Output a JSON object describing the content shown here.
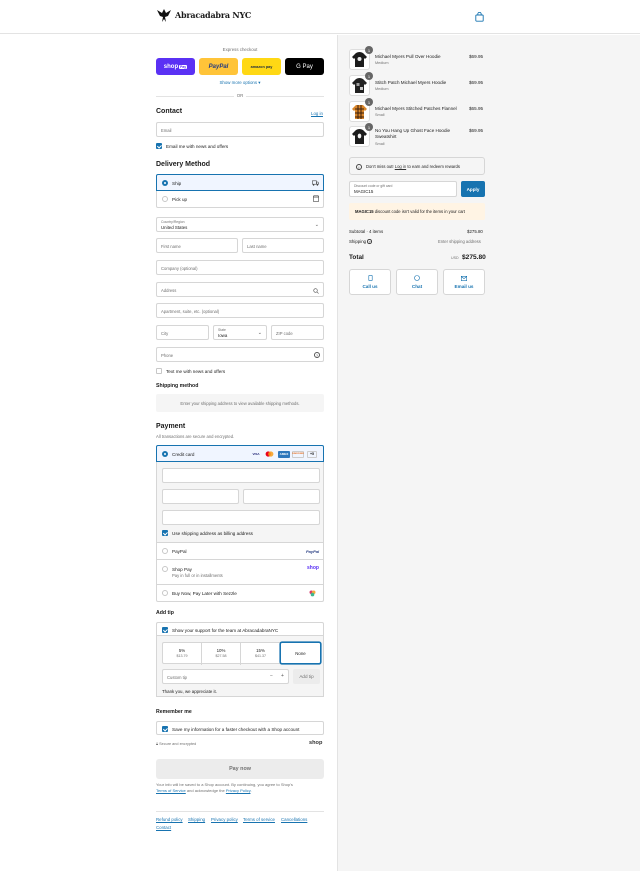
{
  "header": {
    "logo_text": "Abracadabra NYC"
  },
  "express": {
    "title": "Express checkout",
    "shop_pay": "shop",
    "shop_pay_badge": "Pay",
    "paypal": "PayPal",
    "amazon": "amazon pay",
    "gpay": "G Pay",
    "more": "Show more options",
    "or": "OR"
  },
  "contact": {
    "title": "Contact",
    "login": "Log in",
    "email_placeholder": "Email",
    "news": "Email me with news and offers"
  },
  "delivery": {
    "title": "Delivery Method",
    "ship": "Ship",
    "pickup": "Pick up",
    "country_label": "Country/Region",
    "country": "United States",
    "first": "First name",
    "last": "Last name",
    "company": "Company (optional)",
    "address": "Address",
    "apartment": "Apartment, suite, etc. (optional)",
    "city": "City",
    "state_label": "State",
    "state": "Iowa",
    "zip": "ZIP code",
    "phone": "Phone",
    "text_me": "Text me with news and offers"
  },
  "shipping": {
    "title": "Shipping method",
    "note": "Enter your shipping address to view available shipping methods."
  },
  "payment": {
    "title": "Payment",
    "sub": "All transactions are secure and encrypted.",
    "credit": "Credit card",
    "brands": [
      "VISA",
      "MC",
      "AMEX",
      "DISCOVER"
    ],
    "more_brands": "+5",
    "billing": "Use shipping address as billing address",
    "paypal": "PayPal",
    "paypal_logo": "PayPal",
    "shop_pay": "Shop Pay",
    "shop_pay_sub": "Pay in full or in installments",
    "shop_logo": "shop",
    "sezzle": "Buy Now, Pay Later with Sezzle"
  },
  "tip": {
    "title": "Add tip",
    "support": "Show your support for the team at AbracadabraNYC",
    "options": [
      {
        "pct": "5%",
        "amt": "$13.79"
      },
      {
        "pct": "10%",
        "amt": "$27.58"
      },
      {
        "pct": "15%",
        "amt": "$41.37"
      },
      {
        "pct": "None",
        "amt": ""
      }
    ],
    "custom": "Custom tip",
    "add": "Add tip",
    "thanks": "Thank you, we appreciate it."
  },
  "remember": {
    "title": "Remember me",
    "save": "Save my information for a faster checkout with a Shop account",
    "secure": "Secure and encrypted",
    "shop": "shop"
  },
  "pay_now": "Pay now",
  "legal": {
    "line1": "Your info will be saved to a Shop account. By continuing, you agree to Shop's",
    "tos": "Terms of Service",
    "and": "and acknowledge the",
    "privacy": "Privacy Policy",
    "period": "."
  },
  "footer": [
    "Refund policy",
    "Shipping",
    "Privacy policy",
    "Terms of service",
    "Cancellations",
    "Contact"
  ],
  "cart": {
    "items": [
      {
        "qty": "1",
        "name": "Michael Myers Pull Over Hoodie",
        "variant": "Medium",
        "price": "$69.95"
      },
      {
        "qty": "1",
        "name": "Stitch Patch Michael Myers Hoodie",
        "variant": "Medium",
        "price": "$69.95"
      },
      {
        "qty": "1",
        "name": "Michael Myers Stitched Patches Flannel",
        "variant": "Small",
        "price": "$65.95"
      },
      {
        "qty": "1",
        "name": "No You Hang Up Ghost Face Hoodie Sweatshirt",
        "variant": "Small",
        "price": "$69.95"
      }
    ],
    "rewards_pre": "Don't miss out!",
    "rewards_link": "Log in",
    "rewards_post": "to earn and redeem rewards",
    "discount_label": "Discount code or gift card",
    "discount_value": "MAGIC15",
    "apply": "Apply",
    "error_code": "MAGIC15",
    "error_text": "discount code isn't valid for the items in your cart",
    "subtotal_label": "Subtotal · 4 items",
    "subtotal": "$275.80",
    "shipping_label": "Shipping",
    "shipping_value": "Enter shipping address",
    "total_label": "Total",
    "currency": "USD",
    "total": "$275.80",
    "call": "Call us",
    "chat": "Chat",
    "email": "Email us"
  }
}
